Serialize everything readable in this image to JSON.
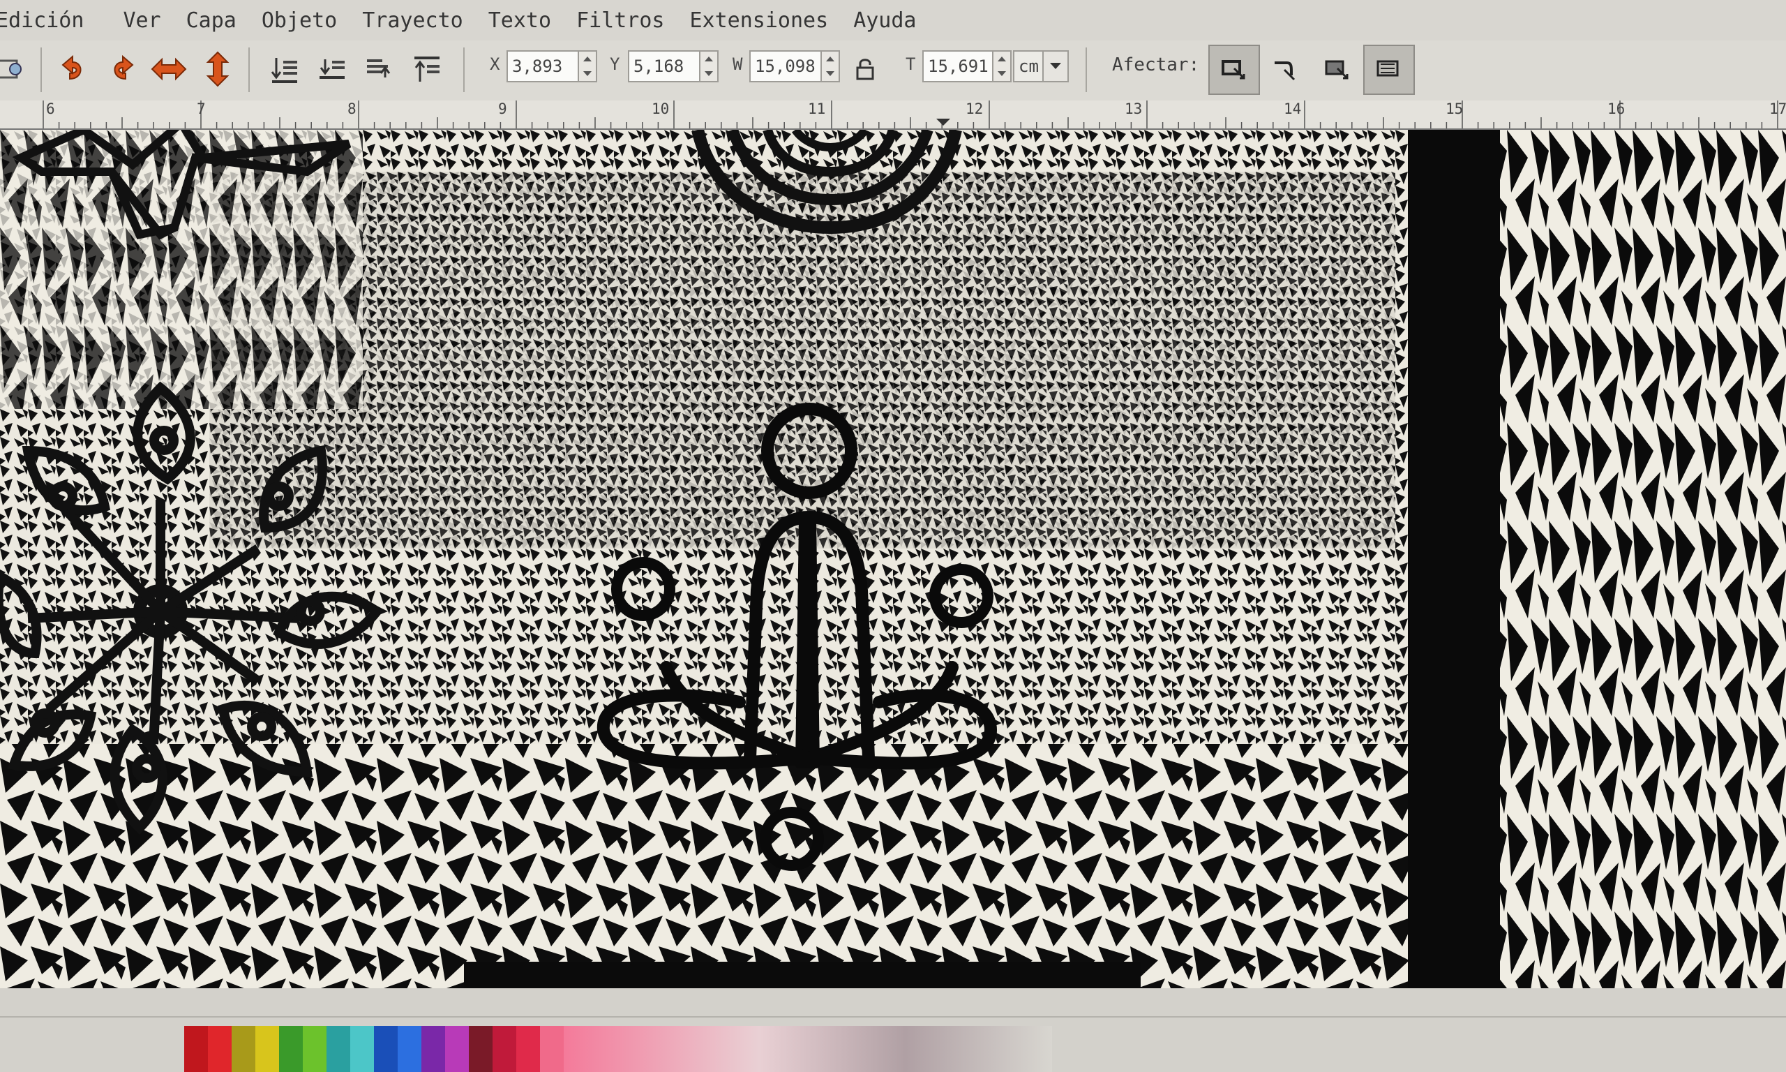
{
  "menu": [
    "Edición",
    "Ver",
    "Capa",
    "Objeto",
    "Trayecto",
    "Texto",
    "Filtros",
    "Extensiones",
    "Ayuda"
  ],
  "toolbar": {
    "x_label": "X",
    "x_value": "3,893",
    "y_label": "Y",
    "y_value": "5,168",
    "w_label": "W",
    "w_value": "15,098",
    "h_label": "T",
    "h_value": "15,691",
    "unit": "cm",
    "affect_label": "Afectar:"
  },
  "ruler": {
    "labels": [
      "6",
      "7",
      "8",
      "9",
      "10",
      "11",
      "12",
      "13",
      "14",
      "15",
      "16",
      "17"
    ]
  },
  "palette": {
    "colors": [
      "#c0171d",
      "#e0262b",
      "#a89a1a",
      "#d8c51c",
      "#3a9a2a",
      "#6cc22c",
      "#2aa0a0",
      "#4cc6c8",
      "#1a4fb8",
      "#2c6fe0",
      "#7a28a8",
      "#b83ab8",
      "#7a1a28",
      "#c01a3a",
      "#e02a4a",
      "#f06a8a"
    ]
  }
}
